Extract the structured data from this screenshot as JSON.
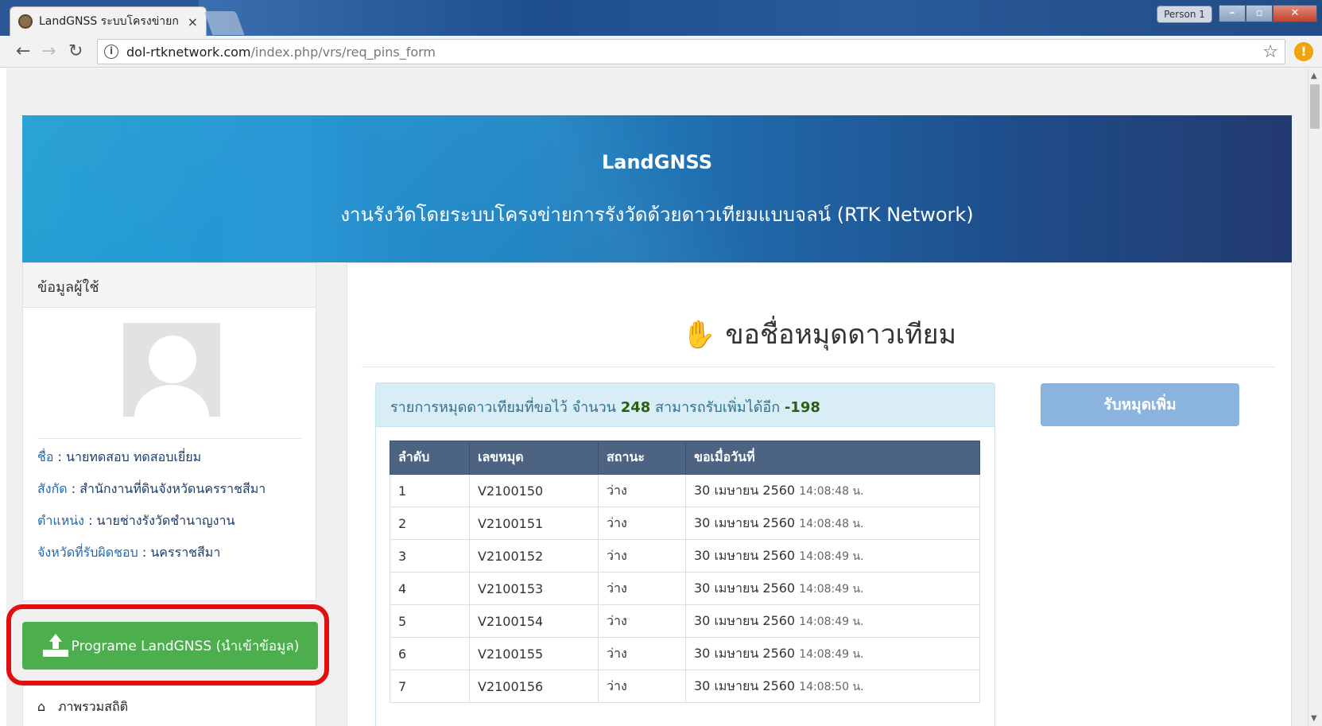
{
  "browser": {
    "tab_title": "LandGNSS ระบบโครงข่ายก",
    "tab_close": "×",
    "profile_label": "Person 1",
    "window_buttons": [
      "–",
      "▫",
      "✕"
    ],
    "url_host": "dol-rtknetwork.com",
    "url_path": "/index.php/vrs/req_pins_form"
  },
  "banner": {
    "title": "LandGNSS",
    "subtitle": "งานรังวัดโดยระบบโครงข่ายการรังวัดด้วยดาวเทียมแบบจลน์ (RTK Network)"
  },
  "sidebar": {
    "panel_title": "ข้อมูลผู้ใช้",
    "name_label": "ชื่อ",
    "name_value": "นายทดสอบ ทดสอบเยี่ยม",
    "office_label": "สังกัด",
    "office_value": "สำนักงานที่ดินจังหวัดนครราชสีมา",
    "position_label": "ตำแหน่ง",
    "position_value": "นายช่างรังวัดชำนาญงาน",
    "province_label": "จังหวัดที่รับผิดชอบ",
    "province_value": "นครราชสีมา",
    "upload_button": "Programe LandGNSS (นำเข้าข้อมูล)",
    "menu_stats": "ภาพรวมสถิติ"
  },
  "main": {
    "title": "ขอชื่อหมุดดาวเทียม",
    "summary_prefix": "รายการหมุดดาวเทียมที่ขอไว้ จำนวน",
    "summary_count": "248",
    "summary_mid": "สามารถรับเพิ่มได้อีก",
    "summary_remaining": "-198",
    "request_button": "รับหมุดเพิ่ม",
    "table_headers": [
      "ลำดับ",
      "เลขหมุด",
      "สถานะ",
      "ขอเมื่อวันที่"
    ],
    "rows": [
      {
        "no": "1",
        "pin": "V2100150",
        "status": "ว่าง",
        "date": "30 เมษายน 2560",
        "time": "14:08:48 น."
      },
      {
        "no": "2",
        "pin": "V2100151",
        "status": "ว่าง",
        "date": "30 เมษายน 2560",
        "time": "14:08:48 น."
      },
      {
        "no": "3",
        "pin": "V2100152",
        "status": "ว่าง",
        "date": "30 เมษายน 2560",
        "time": "14:08:49 น."
      },
      {
        "no": "4",
        "pin": "V2100153",
        "status": "ว่าง",
        "date": "30 เมษายน 2560",
        "time": "14:08:49 น."
      },
      {
        "no": "5",
        "pin": "V2100154",
        "status": "ว่าง",
        "date": "30 เมษายน 2560",
        "time": "14:08:49 น."
      },
      {
        "no": "6",
        "pin": "V2100155",
        "status": "ว่าง",
        "date": "30 เมษายน 2560",
        "time": "14:08:49 น."
      },
      {
        "no": "7",
        "pin": "V2100156",
        "status": "ว่าง",
        "date": "30 เมษายน 2560",
        "time": "14:08:50 น."
      }
    ]
  },
  "colors": {
    "header_row": "#4c6482",
    "success_button": "#4cae4c",
    "primary_disabled": "#8ab4dd",
    "highlight": "#e01010",
    "info_bg": "#d9edf7"
  }
}
